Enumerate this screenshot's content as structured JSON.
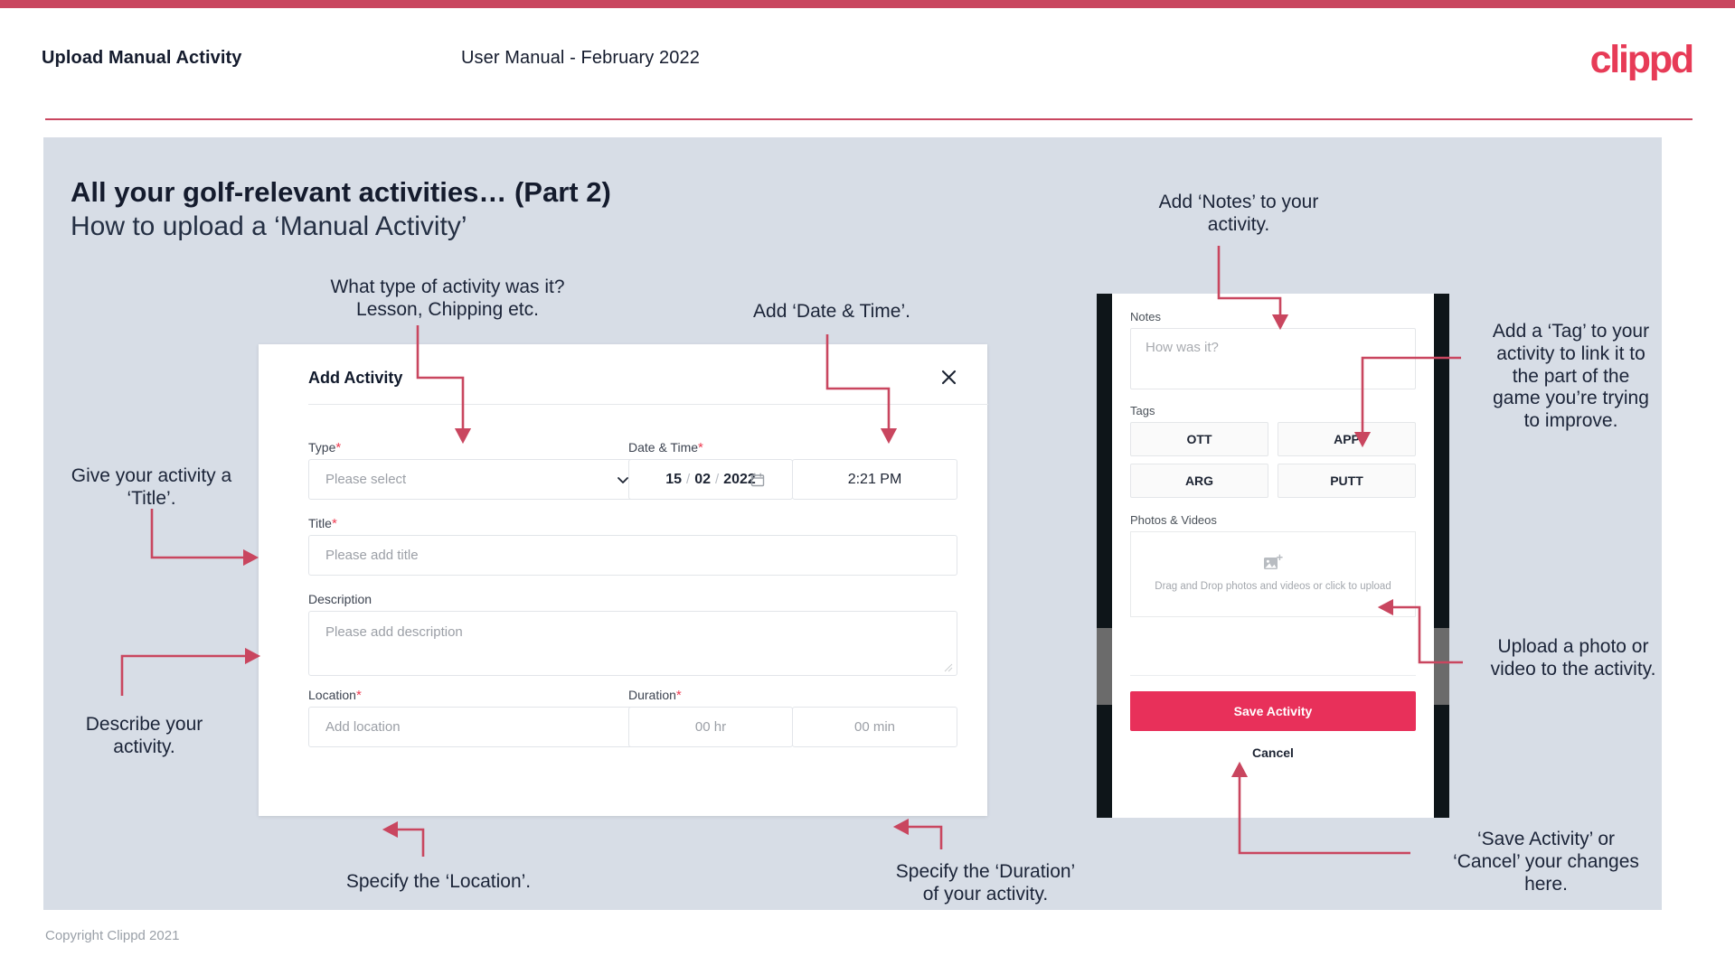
{
  "header": {
    "doc_title": "Upload Manual Activity",
    "doc_subtitle": "User Manual - February 2022",
    "brand": "clippd"
  },
  "slide": {
    "title": "All your golf-relevant activities… (Part 2)",
    "subtitle": "How to upload a ‘Manual Activity’",
    "footer": "Copyright Clippd 2021"
  },
  "dialog": {
    "title": "Add Activity",
    "close_icon": "close-icon",
    "fields": {
      "type": {
        "label": "Type",
        "required": "*",
        "placeholder": "Please select",
        "icon": "chevron-down-icon"
      },
      "datetime": {
        "label": "Date & Time",
        "required": "*",
        "day": "15",
        "month": "02",
        "year": "2022",
        "sep": "/",
        "time": "2:21 PM",
        "icon": "calendar-icon"
      },
      "title": {
        "label": "Title",
        "required": "*",
        "placeholder": "Please add title"
      },
      "description": {
        "label": "Description",
        "placeholder": "Please add description"
      },
      "location": {
        "label": "Location",
        "required": "*",
        "placeholder": "Add location"
      },
      "duration": {
        "label": "Duration",
        "required": "*",
        "hours": "00 hr",
        "minutes": "00 min"
      }
    }
  },
  "phone": {
    "notes_label": "Notes",
    "notes_placeholder": "How was it?",
    "tags_label": "Tags",
    "tags": [
      "OTT",
      "APP",
      "ARG",
      "PUTT"
    ],
    "photos_label": "Photos & Videos",
    "dropzone_icon": "add-image-icon",
    "dropzone_text": "Drag and Drop photos and videos or\nclick to upload",
    "save_label": "Save Activity",
    "cancel_label": "Cancel"
  },
  "annotations": {
    "type": "What type of activity was it?\nLesson, Chipping etc.",
    "datetime": "Add ‘Date & Time’.",
    "title": "Give your activity a\n‘Title’.",
    "description": "Describe your\nactivity.",
    "location": "Specify the ‘Location’.",
    "duration": "Specify the ‘Duration’\nof your activity.",
    "notes": "Add ‘Notes’ to your\nactivity.",
    "tags": "Add a ‘Tag’ to your\nactivity to link it to\nthe part of the\ngame you’re trying\nto improve.",
    "upload": "Upload a photo or\nvideo to the activity.",
    "save": "‘Save Activity’ or\n‘Cancel’ your changes\nhere."
  },
  "colors": {
    "accent_pink": "#e8305a",
    "bar_pink": "#c9465f",
    "slide_bg": "#d7dde6",
    "text_dark": "#141b2d",
    "arrow": "#c9465f"
  }
}
